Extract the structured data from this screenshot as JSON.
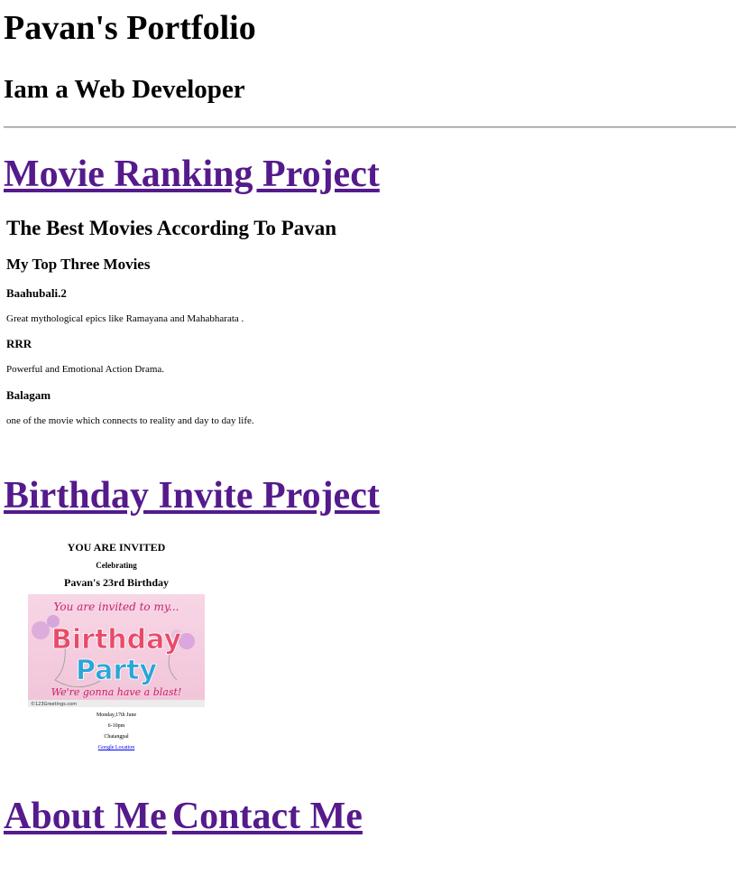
{
  "header": {
    "title": "Pavan's Portfolio",
    "subtitle": "Iam a Web Developer"
  },
  "movie_project": {
    "link": "Movie Ranking Project",
    "heading": "The Best Movies According To Pavan",
    "subheading": "My Top Three Movies",
    "movies": [
      {
        "name": "Baahubali.2",
        "desc": "Great mythological epics like Ramayana and Mahabharata ."
      },
      {
        "name": "RRR",
        "desc": "Powerful and Emotional Action Drama."
      },
      {
        "name": "Balagam",
        "desc": "one of the movie which connects to reality and day to day life."
      }
    ]
  },
  "birthday_project": {
    "link": "Birthday Invite Project",
    "invited": "YOU ARE INVITED",
    "celebrating": "Celebrating",
    "event": "Pavan's 23rd Birthday",
    "image": {
      "top_text": "You are invited to my...",
      "word1": "Birthday",
      "word2": "Party",
      "bottom_text": "We're gonna have a blast!",
      "credit": "©123Greetings.com"
    },
    "date": "Monday,17th June",
    "time": "6-10pm",
    "place": "Chatangpal",
    "map_link": "Google Location"
  },
  "footer": {
    "about": "About Me",
    "contact": "Contact Me"
  },
  "colors": {
    "visited_link": "#551a8b",
    "link": "#0000ee",
    "rule": "#8f8f8f",
    "card_pink": "#f5cfe0"
  }
}
